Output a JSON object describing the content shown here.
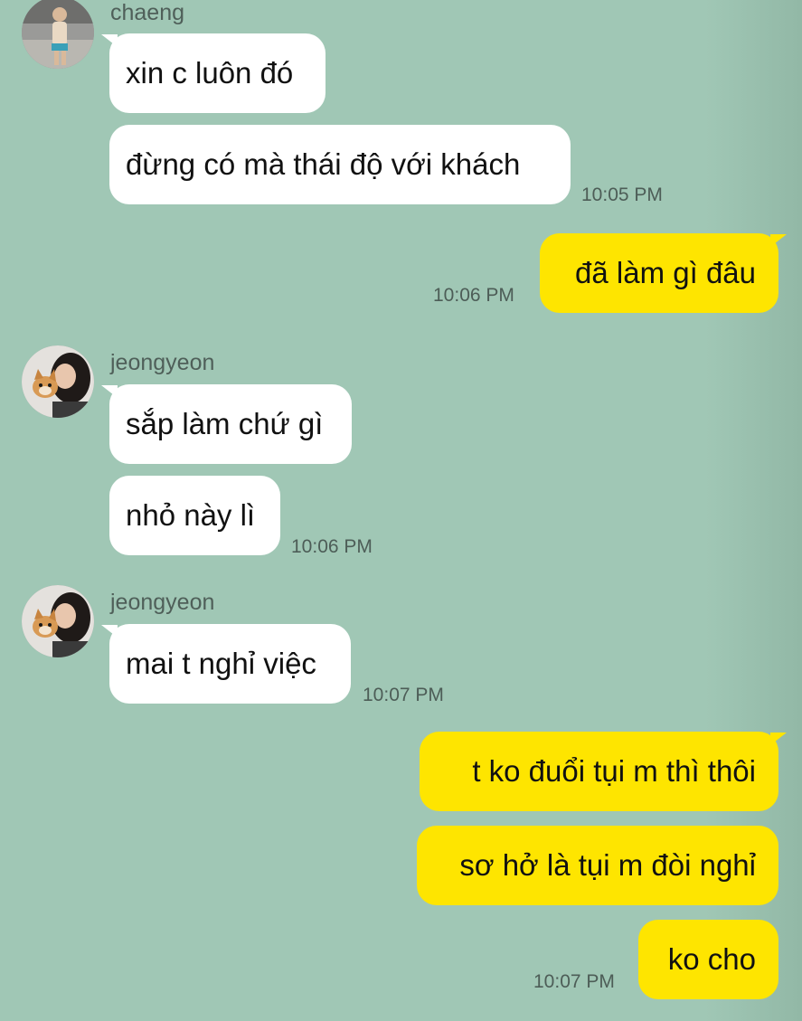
{
  "messages": [
    {
      "sender": "chaeng",
      "text": "xin c luôn đó"
    },
    {
      "sender": "chaeng",
      "text": "đừng có mà thái độ với khách",
      "time": "10:05 PM"
    },
    {
      "sender": "me",
      "text": "đã làm gì đâu",
      "time": "10:06 PM"
    },
    {
      "sender": "jeongyeon",
      "text": "sắp làm chứ gì"
    },
    {
      "sender": "jeongyeon",
      "text": "nhỏ này lì",
      "time": "10:06 PM"
    },
    {
      "sender": "jeongyeon",
      "text": "mai t nghỉ việc",
      "time": "10:07 PM"
    },
    {
      "sender": "me",
      "text": "t ko đuổi tụi m thì thôi"
    },
    {
      "sender": "me",
      "text": "sơ hở là tụi m đòi nghỉ"
    },
    {
      "sender": "me",
      "text": "ko cho",
      "time": "10:07 PM"
    }
  ]
}
